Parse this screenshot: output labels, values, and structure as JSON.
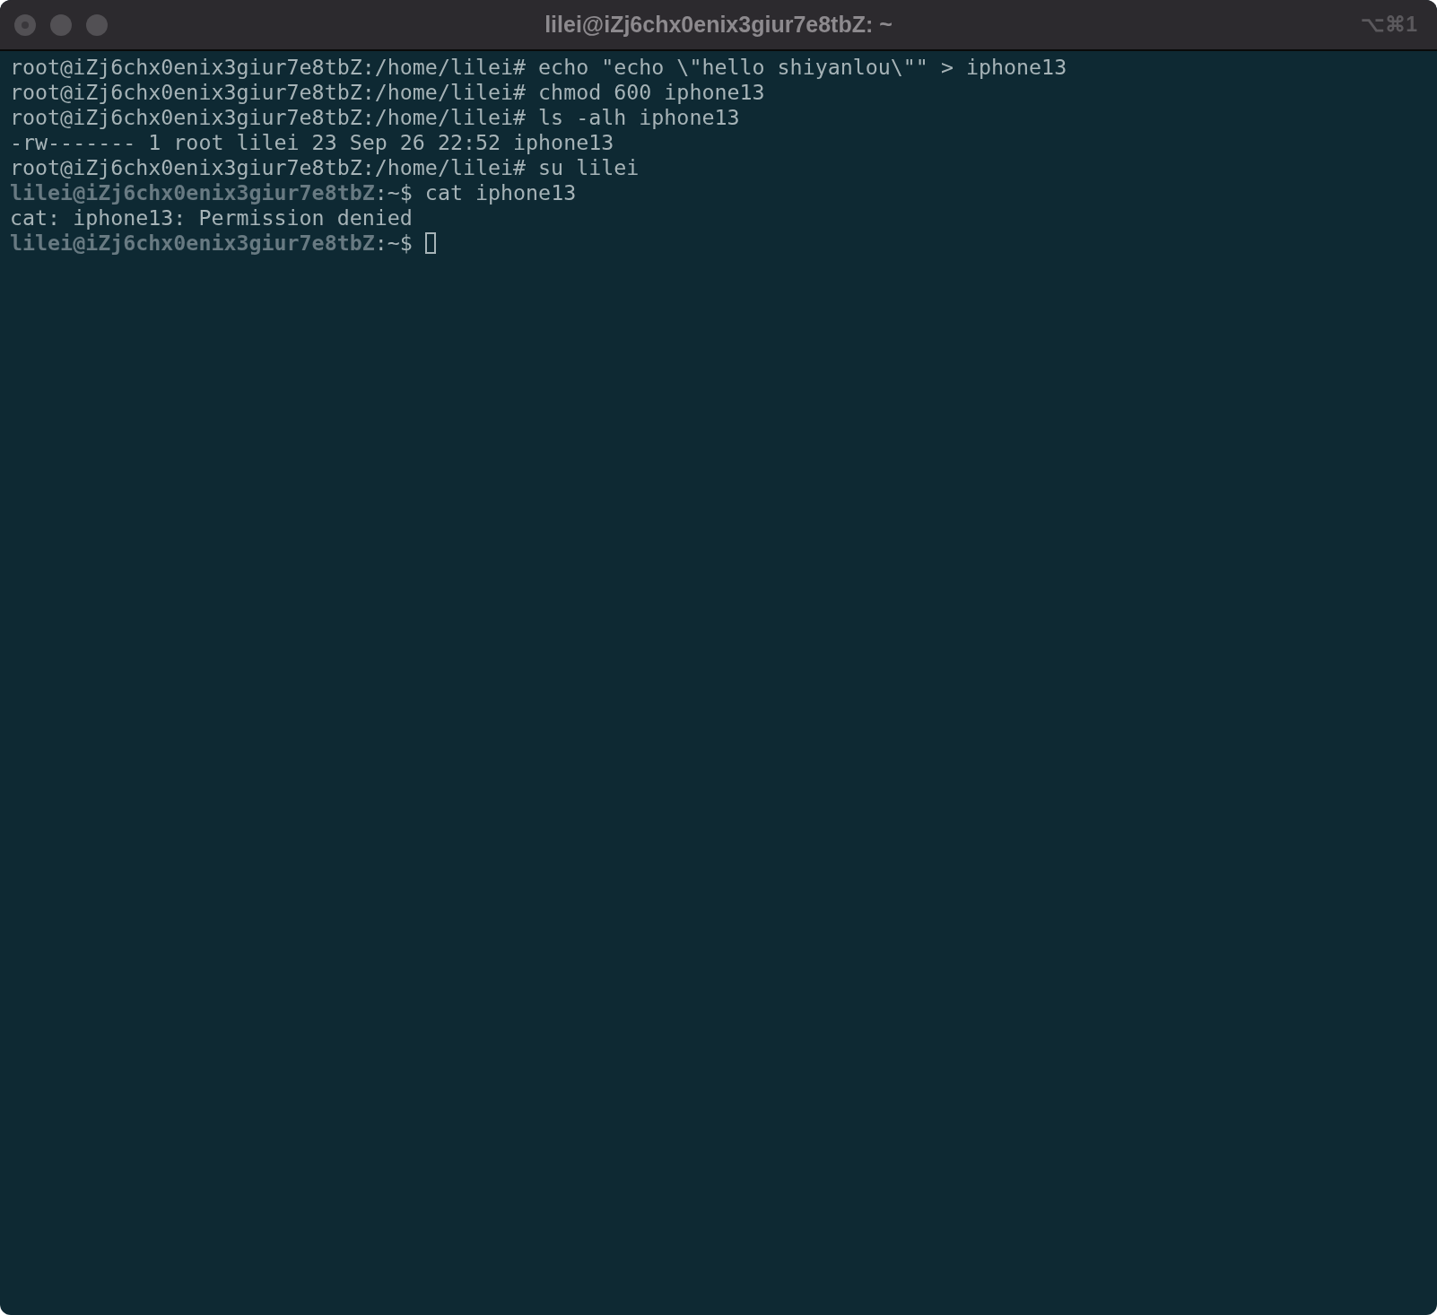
{
  "window": {
    "title": "lilei@iZj6chx0enix3giur7e8tbZ: ~",
    "shortcut": "⌥⌘1"
  },
  "terminal": {
    "lines": [
      {
        "text": "root@iZj6chx0enix3giur7e8tbZ:/home/lilei# echo \"echo \\\"hello shiyanlou\\\"\" > iphone13",
        "cursor": false
      },
      {
        "text": "root@iZj6chx0enix3giur7e8tbZ:/home/lilei# chmod 600 iphone13",
        "cursor": false
      },
      {
        "text": "root@iZj6chx0enix3giur7e8tbZ:/home/lilei# ls -alh iphone13",
        "cursor": false
      },
      {
        "text": "-rw------- 1 root lilei 23 Sep 26 22:52 iphone13",
        "cursor": false
      },
      {
        "text": "root@iZj6chx0enix3giur7e8tbZ:/home/lilei# su lilei",
        "cursor": false
      },
      {
        "text": "**lilei@iZj6chx0enix3giur7e8tbZ**:~$ cat iphone13",
        "cursor": false
      },
      {
        "text": "cat: iphone13: Permission denied",
        "cursor": false
      },
      {
        "text": "**lilei@iZj6chx0enix3giur7e8tbZ**:~$ ",
        "cursor": true
      }
    ]
  }
}
